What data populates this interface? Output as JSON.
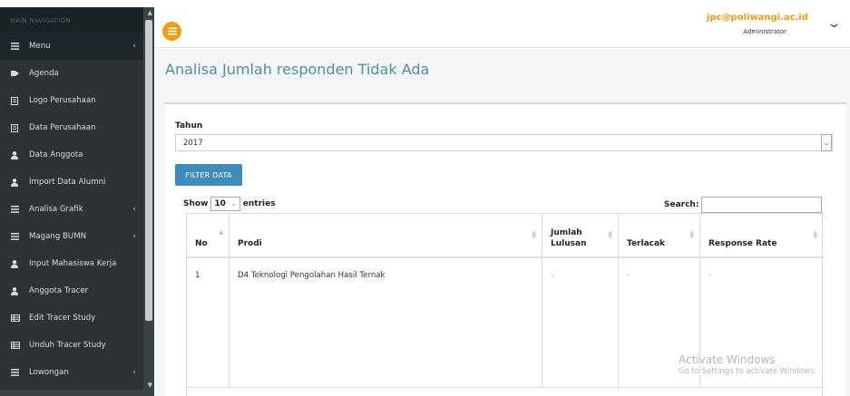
{
  "sidebar": {
    "header": "MAIN NAVIGATION",
    "items": [
      {
        "label": "Menu",
        "icon": "bars-icon",
        "caret": "‹"
      },
      {
        "label": "Agenda",
        "icon": "tag-icon",
        "caret": ""
      },
      {
        "label": "Logo Perusahaan",
        "icon": "document-icon",
        "caret": ""
      },
      {
        "label": "Data Perusahaan",
        "icon": "document-icon",
        "caret": ""
      },
      {
        "label": "Data Anggota",
        "icon": "user-icon",
        "caret": ""
      },
      {
        "label": "Import Data Alumni",
        "icon": "user-icon",
        "caret": ""
      },
      {
        "label": "Analisa Grafik",
        "icon": "bars-icon",
        "caret": "‹"
      },
      {
        "label": "Magang BUMN",
        "icon": "bars-icon",
        "caret": "‹"
      },
      {
        "label": "Input Mahasiswa Kerja",
        "icon": "user-icon",
        "caret": ""
      },
      {
        "label": "Anggota Tracer",
        "icon": "user-icon",
        "caret": ""
      },
      {
        "label": "Edit Tracer Study",
        "icon": "table-icon",
        "caret": ""
      },
      {
        "label": "Unduh Tracer Study",
        "icon": "table-icon",
        "caret": ""
      },
      {
        "label": "Lowongan",
        "icon": "bars-icon",
        "caret": "‹"
      }
    ]
  },
  "navbar": {
    "user_email": "jpc@poliwangi.ac.id",
    "user_role": "Administrator",
    "accent_color": "#f39c12"
  },
  "page": {
    "title": "Analisa Jumlah responden Tidak Ada"
  },
  "filter": {
    "tahun_label": "Tahun",
    "tahun_value": "2017",
    "button_label": "FILTER DATA"
  },
  "datatable": {
    "show_label": "Show",
    "length_value": "10",
    "entries_label": "entries",
    "search_label": "Search:",
    "columns": [
      "No",
      "Prodi",
      "Jumlah\nLulusan",
      "Terlacak",
      "Response Rate"
    ],
    "rows": [
      [
        "1",
        "D4 Teknologi Pengolahan Hasil Ternak",
        "-",
        "-",
        "-"
      ]
    ]
  },
  "watermark": {
    "line1": "Activate Windows",
    "line2": "Go to Settings to activate Windows."
  }
}
